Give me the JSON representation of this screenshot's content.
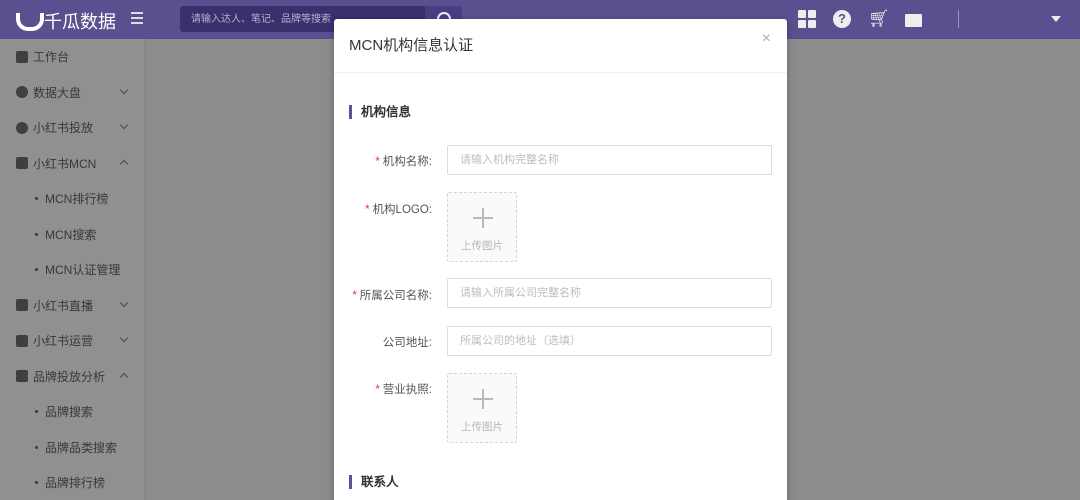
{
  "app": {
    "title": "千瓜数据"
  },
  "search": {
    "placeholder": "请输入达人、笔记、品牌等搜索"
  },
  "sidebar": {
    "items": [
      {
        "label": "工作台",
        "icon": "dashboard-icon"
      },
      {
        "label": "数据大盘",
        "icon": "pie-chart-icon",
        "expand": "down"
      },
      {
        "label": "小红书投放",
        "icon": "dollar-icon",
        "expand": "down"
      },
      {
        "label": "小红书MCN",
        "icon": "building-icon",
        "expand": "up"
      },
      {
        "label": "MCN排行榜",
        "sub": true
      },
      {
        "label": "MCN搜索",
        "sub": true
      },
      {
        "label": "MCN认证管理",
        "sub": true
      },
      {
        "label": "小红书直播",
        "icon": "video-icon",
        "expand": "down"
      },
      {
        "label": "小红书运营",
        "icon": "store-icon",
        "expand": "down"
      },
      {
        "label": "品牌投放分析",
        "icon": "trend-chart-icon",
        "expand": "up"
      },
      {
        "label": "品牌搜索",
        "sub": true
      },
      {
        "label": "品牌品类搜索",
        "sub": true
      },
      {
        "label": "品牌排行榜",
        "sub": true
      }
    ]
  },
  "modal": {
    "title": "MCN机构信息认证",
    "close": "×",
    "section_org": "机构信息",
    "section_contact": "联系人",
    "fields": {
      "org_name": {
        "label": "机构名称:",
        "required": "*",
        "placeholder": "请输入机构完整名称"
      },
      "org_logo": {
        "label": "机构LOGO:",
        "required": "*",
        "upload_label": "上传图片"
      },
      "company_name": {
        "label": "所属公司名称:",
        "required": "*",
        "placeholder": "请输入所属公司完整名称"
      },
      "company_address": {
        "label": "公司地址:",
        "placeholder": "所属公司的地址（选填）"
      },
      "business_license": {
        "label": "营业执照:",
        "required": "*",
        "upload_label": "上传图片"
      }
    }
  },
  "colors": {
    "brand_purple": "#5b4fa0",
    "required_red": "#e4393c"
  }
}
